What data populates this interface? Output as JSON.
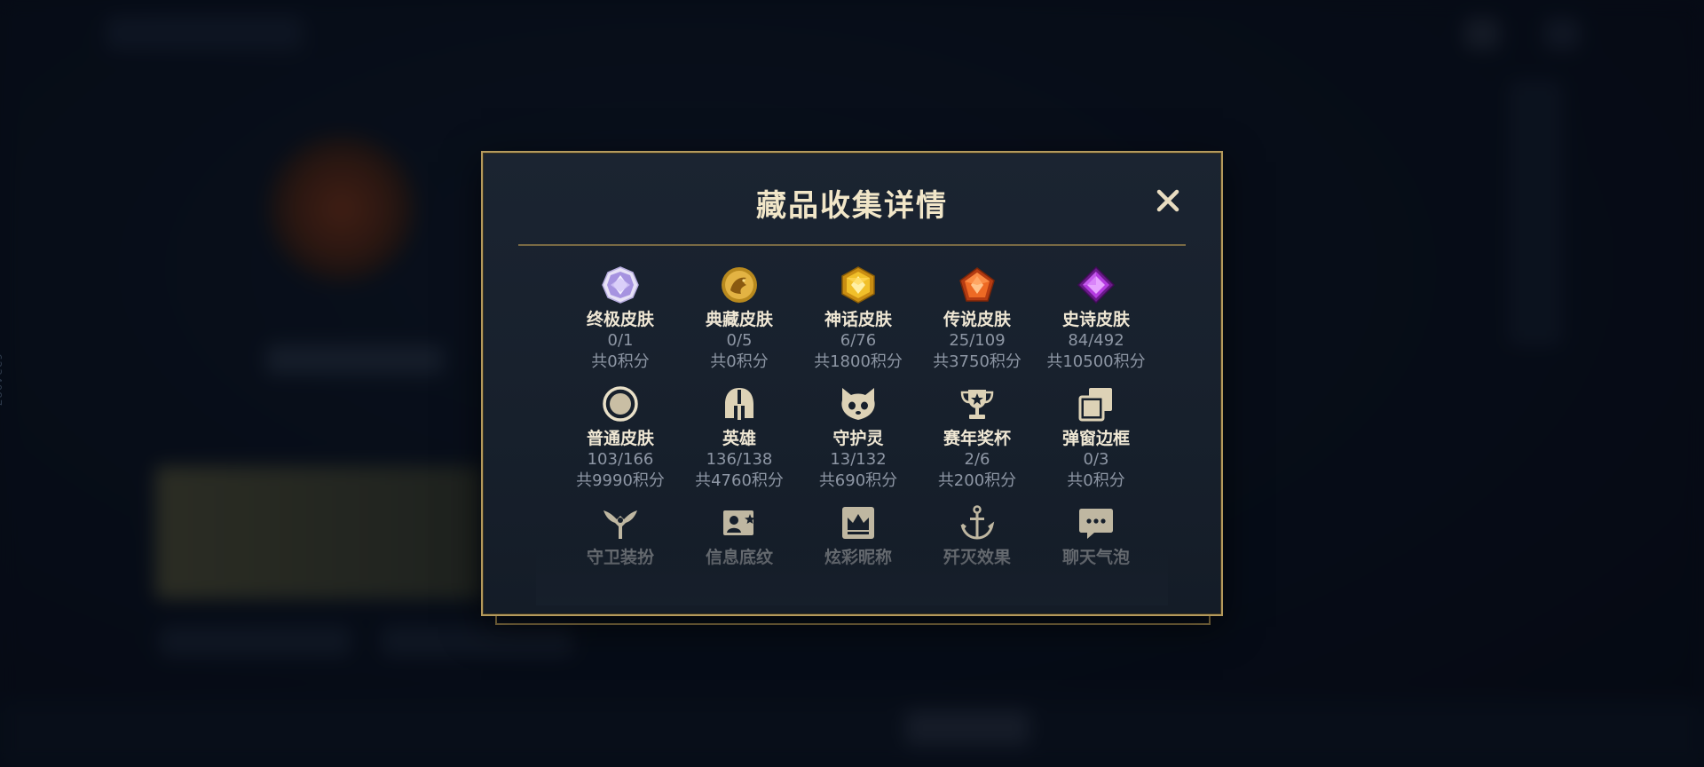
{
  "background": {
    "side_id": "6234087"
  },
  "modal": {
    "title": "藏品收集详情",
    "close_icon": "close-icon",
    "accent_color": "#b59a5c"
  },
  "rows": [
    [
      {
        "icon": "ultimate-skin-icon",
        "name": "终极皮肤",
        "count": "0/1",
        "points": "共0积分"
      },
      {
        "icon": "collector-skin-icon",
        "name": "典藏皮肤",
        "count": "0/5",
        "points": "共0积分"
      },
      {
        "icon": "mythic-skin-icon",
        "name": "神话皮肤",
        "count": "6/76",
        "points": "共1800积分"
      },
      {
        "icon": "legendary-skin-icon",
        "name": "传说皮肤",
        "count": "25/109",
        "points": "共3750积分"
      },
      {
        "icon": "epic-skin-icon",
        "name": "史诗皮肤",
        "count": "84/492",
        "points": "共10500积分"
      }
    ],
    [
      {
        "icon": "regular-skin-icon",
        "name": "普通皮肤",
        "count": "103/166",
        "points": "共9990积分"
      },
      {
        "icon": "champion-helmet-icon",
        "name": "英雄",
        "count": "136/138",
        "points": "共4760积分"
      },
      {
        "icon": "guardian-icon",
        "name": "守护灵",
        "count": "13/132",
        "points": "共690积分"
      },
      {
        "icon": "trophy-icon",
        "name": "赛年奖杯",
        "count": "2/6",
        "points": "共200积分"
      },
      {
        "icon": "frame-icon",
        "name": "弹窗边框",
        "count": "0/3",
        "points": "共0积分"
      }
    ],
    [
      {
        "icon": "ward-skin-icon",
        "name": "守卫装扮"
      },
      {
        "icon": "profile-banner-icon",
        "name": "信息底纹"
      },
      {
        "icon": "nickname-crown-icon",
        "name": "炫彩昵称"
      },
      {
        "icon": "ace-effect-icon",
        "name": "歼灭效果"
      },
      {
        "icon": "chat-bubble-icon",
        "name": "聊天气泡"
      }
    ]
  ]
}
